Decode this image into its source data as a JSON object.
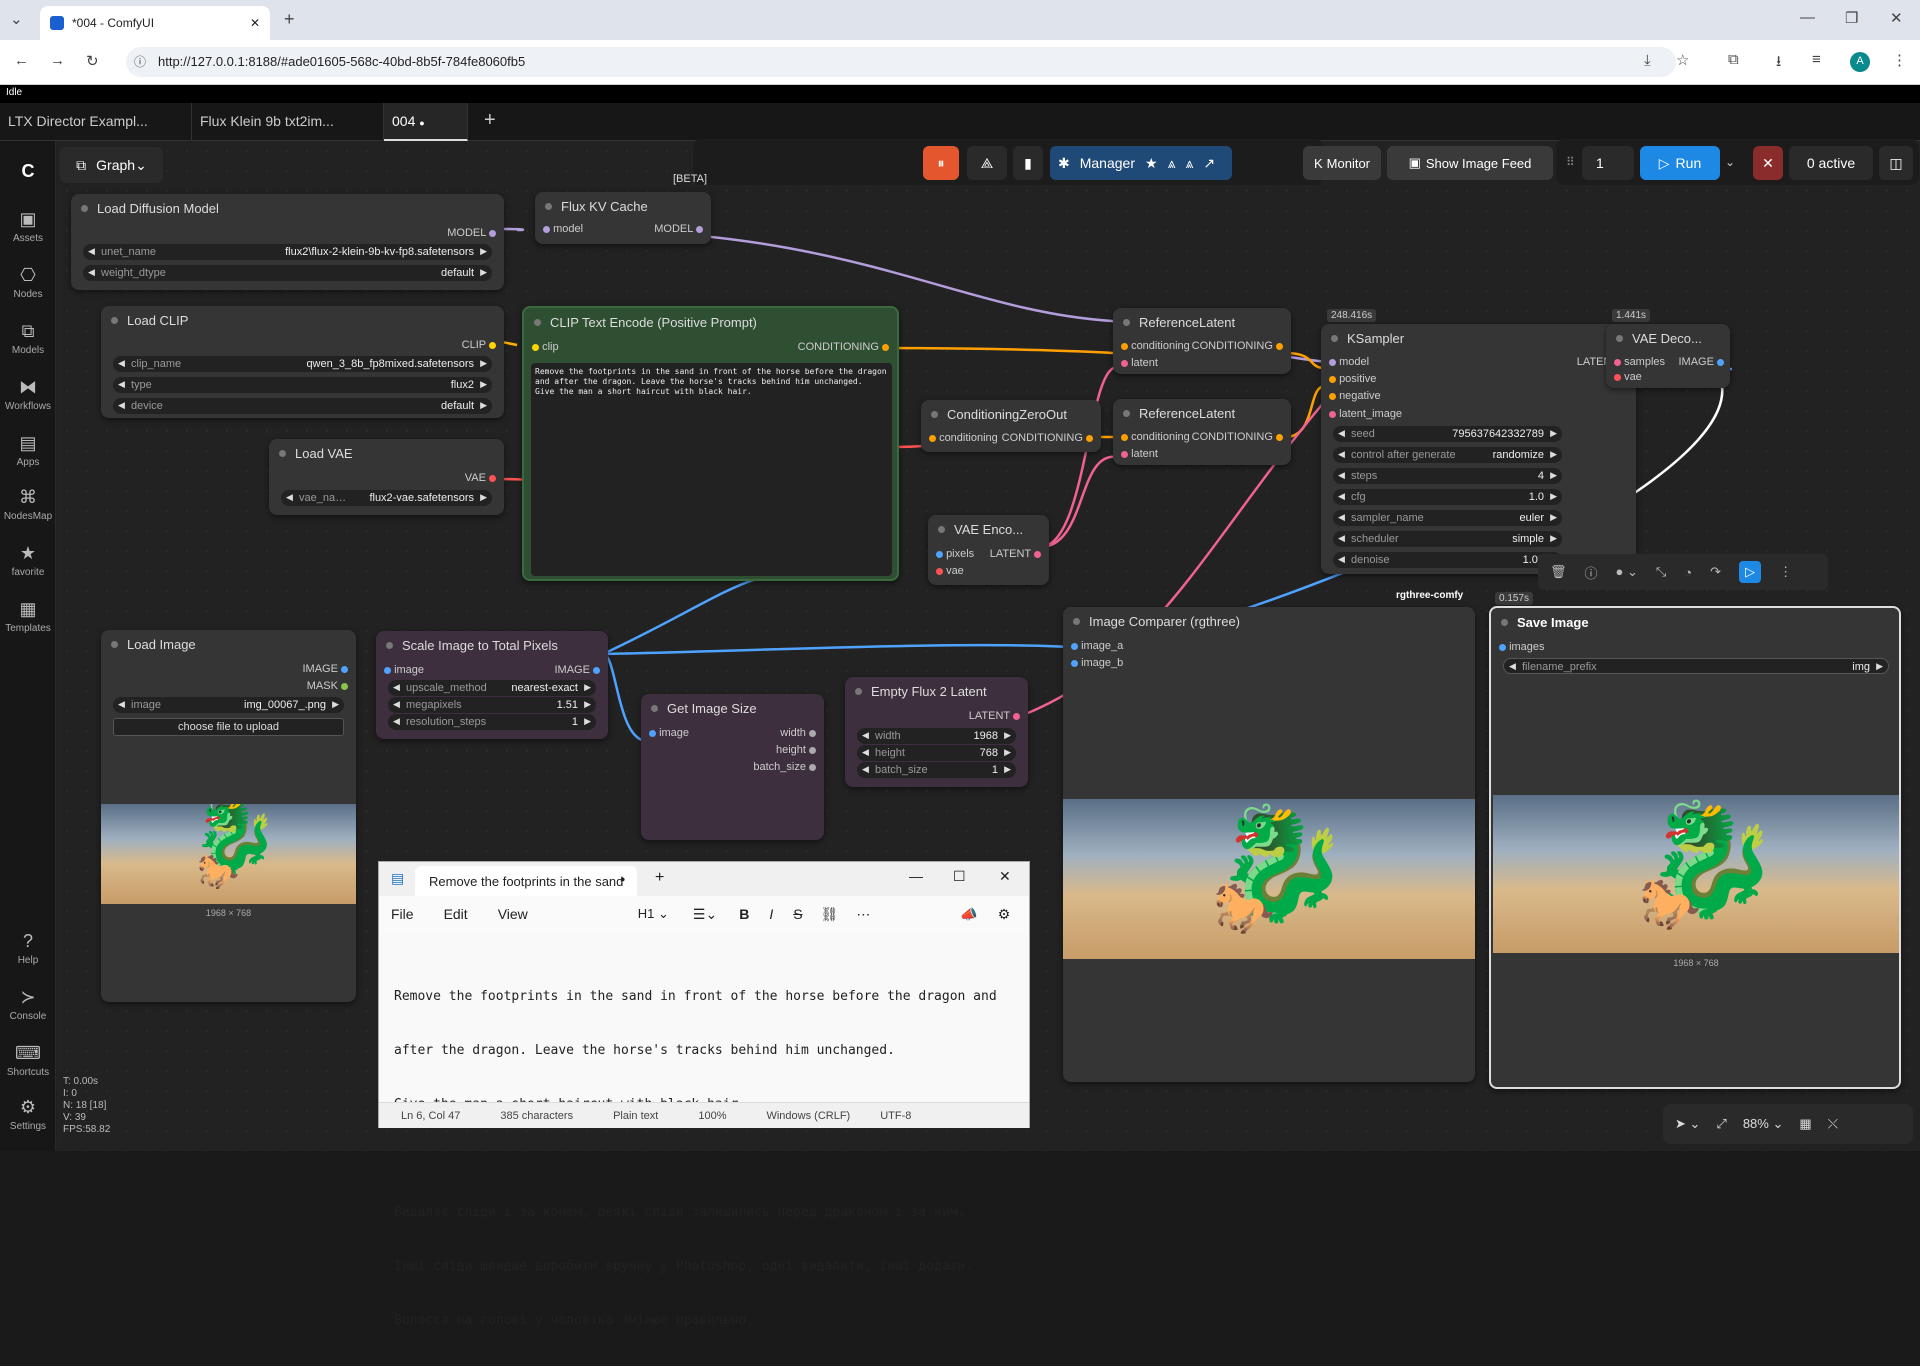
{
  "browser": {
    "tab_title": "*004 - ComfyUI",
    "url": "http://127.0.0.1:8188/#ade01605-568c-40bd-8b5f-784fe8060fb5",
    "profile": "A"
  },
  "status": {
    "idle": "Idle"
  },
  "workflow_tabs": [
    "LTX Director Exampl...",
    "Flux Klein 9b txt2im...",
    "004"
  ],
  "toolbar": {
    "graph": "Graph",
    "manager": "Manager",
    "monitor": "Monitor",
    "image_feed": "Show Image Feed",
    "queue_count": "1",
    "run": "Run",
    "active": "0 active",
    "beta": "[BETA]"
  },
  "sidebar": [
    "Assets",
    "Nodes",
    "Models",
    "Workflows",
    "Apps",
    "NodesMap",
    "favorite",
    "Templates",
    "Help",
    "Console",
    "Shortcuts",
    "Settings"
  ],
  "stats": [
    "T: 0.00s",
    "I: 0",
    "N: 18 [18]",
    "V: 39",
    "FPS:58.82"
  ],
  "nodes": {
    "load_diffusion": {
      "title": "Load Diffusion Model",
      "out": "MODEL",
      "unet_label": "unet_name",
      "unet": "flux2\\flux-2-klein-9b-kv-fp8.safetensors",
      "dtype_label": "weight_dtype",
      "dtype": "default"
    },
    "flux_kv": {
      "title": "Flux KV Cache",
      "in": "model",
      "out": "MODEL"
    },
    "load_clip": {
      "title": "Load CLIP",
      "out": "CLIP",
      "clip_label": "clip_name",
      "clip": "qwen_3_8b_fp8mixed.safetensors",
      "type_label": "type",
      "type": "flux2",
      "device_label": "device",
      "device": "default"
    },
    "load_vae": {
      "title": "Load VAE",
      "out": "VAE",
      "vae_label": "vae_na…",
      "vae": "flux2-vae.safetensors"
    },
    "clip_text": {
      "title": "CLIP Text Encode (Positive Prompt)",
      "in": "clip",
      "out": "CONDITIONING",
      "text": "Remove the footprints in the sand in front of the horse before the dragon and after the dragon. Leave the horse's tracks behind him unchanged.\nGive the man a short haircut with black hair."
    },
    "cond_zero": {
      "title": "ConditioningZeroOut",
      "in": "conditioning",
      "out": "CONDITIONING"
    },
    "ref1": {
      "title": "ReferenceLatent",
      "in1": "conditioning",
      "in2": "latent",
      "out": "CONDITIONING"
    },
    "ref2": {
      "title": "ReferenceLatent",
      "in1": "conditioning",
      "in2": "latent",
      "out": "CONDITIONING"
    },
    "vae_enc": {
      "title": "VAE Enco...",
      "in1": "pixels",
      "in2": "vae",
      "out": "LATENT"
    },
    "ksampler": {
      "time": "248.416s",
      "title": "KSampler",
      "in": [
        "model",
        "positive",
        "negative",
        "latent_image"
      ],
      "out": "LATENT",
      "seed_label": "seed",
      "seed": "795637642332789",
      "cag_label": "control after generate",
      "cag": "randomize",
      "steps_label": "steps",
      "steps": "4",
      "cfg_label": "cfg",
      "cfg": "1.0",
      "sampler_label": "sampler_name",
      "sampler": "euler",
      "sched_label": "scheduler",
      "sched": "simple",
      "denoise_label": "denoise",
      "denoise": "1.00"
    },
    "vae_dec": {
      "time": "1.441s",
      "title": "VAE Deco...",
      "in1": "samples",
      "in2": "vae",
      "out": "IMAGE"
    },
    "load_image": {
      "title": "Load Image",
      "out1": "IMAGE",
      "out2": "MASK",
      "img_label": "image",
      "img": "img_00067_.png",
      "upload": "choose file to upload",
      "size": "1968 × 768"
    },
    "scale": {
      "title": "Scale Image to Total Pixels",
      "in": "image",
      "out": "IMAGE",
      "m_label": "upscale_method",
      "m": "nearest-exact",
      "mp_label": "megapixels",
      "mp": "1.51",
      "rs_label": "resolution_steps",
      "rs": "1"
    },
    "get_size": {
      "title": "Get Image Size",
      "in": "image",
      "o1": "width",
      "o2": "height",
      "o3": "batch_size"
    },
    "empty_latent": {
      "title": "Empty Flux 2 Latent",
      "out": "LATENT",
      "w_label": "width",
      "w": "1968",
      "h_label": "height",
      "h": "768",
      "b_label": "batch_size",
      "b": "1"
    },
    "comparer": {
      "badge": "rgthree-comfy",
      "title": "Image Comparer (rgthree)",
      "in1": "image_a",
      "in2": "image_b"
    },
    "save": {
      "time": "0.157s",
      "title": "Save Image",
      "in": "images",
      "fp_label": "filename_prefix",
      "fp": "img",
      "size": "1968 × 768"
    }
  },
  "notepad": {
    "tab": "Remove the footprints in the sand",
    "menu": [
      "File",
      "Edit",
      "View"
    ],
    "heading": "H1",
    "lines": [
      "Remove the footprints in the sand in front of the horse before the dragon and",
      "after the dragon. Leave the horse's tracks behind him unchanged.",
      "Give the man a short haircut with black hair.",
      "",
      "Видаляє сліди і за конем, деякі сліди залишились перед драконом і за ним.",
      "Інші сліди швидше доробити вручну у Photoshop, одні видалити, інші додати.",
      "Волосся на голові у чоловіка змінює правильно."
    ],
    "status": [
      "Ln 6, Col 47",
      "385 characters",
      "Plain text",
      "100%",
      "Windows (CRLF)",
      "UTF-8"
    ]
  },
  "zoom": "88%"
}
